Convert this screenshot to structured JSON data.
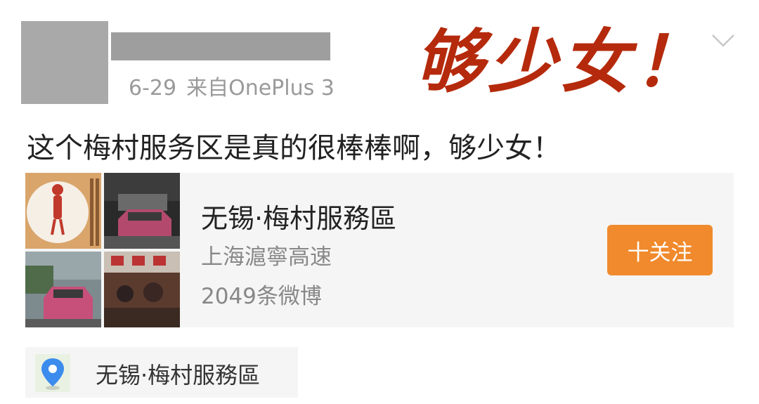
{
  "post": {
    "meta": {
      "date": "6-29",
      "source": "来自OnePlus 3"
    },
    "caption_overlay": "够少女！",
    "text": "这个梅村服务区是真的很棒棒啊，够少女！"
  },
  "place_card": {
    "title": "无锡·梅村服務區",
    "subtitle": "上海滬寧高速",
    "count": "2049条微博",
    "follow_label": "十关注",
    "thumbnails": [
      "plate-illustration",
      "pink-car-night",
      "pink-car-parking",
      "restaurant-interior"
    ]
  },
  "location": {
    "label": "无锡·梅村服務區",
    "icon": "location-pin-icon"
  },
  "colors": {
    "caption": "#b52a0c",
    "follow_button": "#f08a2c",
    "card_bg": "#f5f5f5",
    "location_pin": "#3b8ced"
  }
}
